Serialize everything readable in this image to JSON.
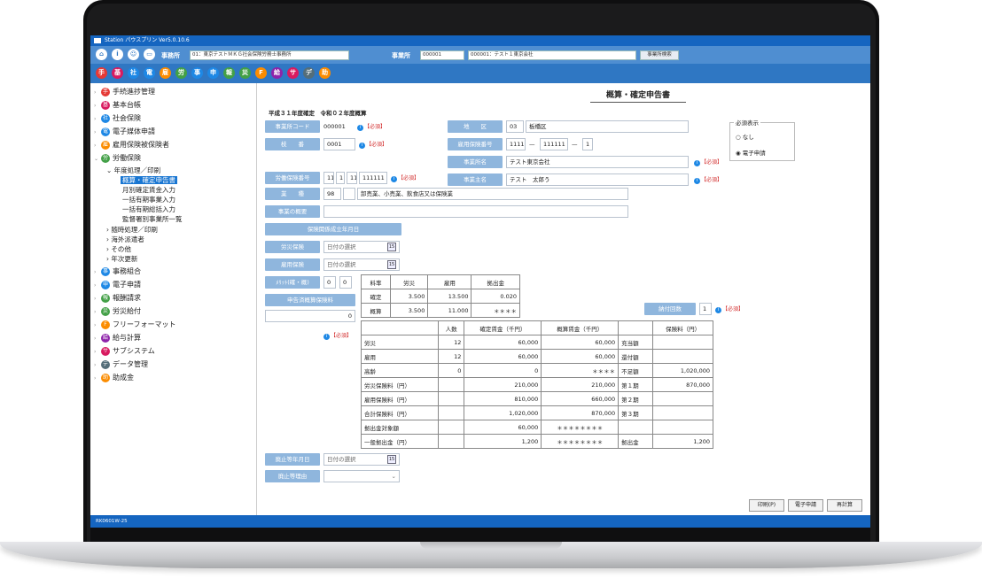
{
  "window": {
    "title": "Station パウスプリン Ver5.0.10.6"
  },
  "toolbar": {
    "office_label": "事務所",
    "office_select": "01：東京テストＭＫＧ社会保険労務士事務所",
    "business_label": "事業所",
    "business_code": "000001",
    "business_select": "000001：テスト１東京会社",
    "search_button": "事業所検索"
  },
  "sidebar": {
    "items": [
      {
        "label": "手続進捗管理",
        "color": "#e53935",
        "glyph": "手"
      },
      {
        "label": "基本台帳",
        "color": "#d81b60",
        "glyph": "基"
      },
      {
        "label": "社会保険",
        "color": "#1e88e5",
        "glyph": "社"
      },
      {
        "label": "電子媒体申請",
        "color": "#1e88e5",
        "glyph": "電"
      },
      {
        "label": "雇用保険被保険者",
        "color": "#fb8c00",
        "glyph": "雇"
      },
      {
        "label": "労働保険",
        "color": "#43a047",
        "glyph": "労"
      },
      {
        "label": "事務組合",
        "color": "#1e88e5",
        "glyph": "事"
      },
      {
        "label": "電子申請",
        "color": "#1e88e5",
        "glyph": "申"
      },
      {
        "label": "報酬請求",
        "color": "#43a047",
        "glyph": "報"
      },
      {
        "label": "労災給付",
        "color": "#43a047",
        "glyph": "災"
      },
      {
        "label": "フリーフォーマット",
        "color": "#fb8c00",
        "glyph": "F"
      },
      {
        "label": "給与計算",
        "color": "#8e24aa",
        "glyph": "給"
      },
      {
        "label": "サブシステム",
        "color": "#d81b60",
        "glyph": "サ"
      },
      {
        "label": "データ管理",
        "color": "#546e7a",
        "glyph": "デ"
      },
      {
        "label": "助成金",
        "color": "#fb8c00",
        "glyph": "助"
      }
    ],
    "sub_group": "年度処理／印刷",
    "sub_items": [
      "概算・確定申告書",
      "月別確定賃金入力",
      "一括有期事業入力",
      "一括有期総括入力",
      "監督署別事業所一覧"
    ],
    "other_items": [
      "随時処理／印刷",
      "海外派遣者",
      "その他",
      "年次更新"
    ]
  },
  "form": {
    "title": "概算・確定申告書",
    "year_note": "平成３１年度確定　令和０２年度概算",
    "required_tag": "【必須】",
    "office_code_label": "事業所コード",
    "office_code": "000001",
    "branch_label": "枝　　番",
    "branch": "0001",
    "district_label": "地　　区",
    "district_code": "03",
    "district_name": "板橋区",
    "emp_ins_no_label": "雇用保険番号",
    "emp_ins_no": [
      "1111",
      "111111",
      "1"
    ],
    "biz_name_label": "事業所名",
    "biz_name": "テスト東京会社",
    "owner_label": "事業主名",
    "owner": "テスト　太郎う",
    "labor_ins_no_label": "労働保険番号",
    "labor_ins_no": [
      "11",
      "1",
      "11",
      "111111"
    ],
    "industry_label": "業　　種",
    "industry_code": "98",
    "industry_name": "卸売業、小売業、飲食店又は保険業",
    "business_summary_label": "事業の概要",
    "established_label": "保険関係成立年月日",
    "rosai_label": "労災保険",
    "koyo_label": "雇用保険",
    "date_placeholder": "日付の選択",
    "maint_label": "ﾒﾘｯﾄ(確・概)",
    "maint": [
      "0",
      "0"
    ],
    "declared_label": "申告済概算保険料",
    "declared_value": "0",
    "installments_label": "納付回数",
    "installments": "1",
    "closure_date_label": "廃止等年月日",
    "closure_reason_label": "廃止等理由"
  },
  "required_panel": {
    "title": "必須表示",
    "options": [
      "なし",
      "電子申請"
    ],
    "selected": "電子申請"
  },
  "rate_table": {
    "headers": [
      "料率",
      "労災",
      "雇用",
      "拠出金"
    ],
    "rows": [
      [
        "確定",
        "3.500",
        "13.500",
        "0.020"
      ],
      [
        "概算",
        "3.500",
        "11.000",
        "＊＊＊＊"
      ]
    ]
  },
  "main_table": {
    "headers": [
      "",
      "人数",
      "確定賃金（千円）",
      "概算賃金（千円）",
      "",
      "保険料（円）"
    ],
    "rows": [
      [
        "労災",
        "12",
        "60,000",
        "60,000",
        "充当額",
        ""
      ],
      [
        "雇用",
        "12",
        "60,000",
        "60,000",
        "還付額",
        ""
      ],
      [
        "高齢",
        "0",
        "0",
        "＊＊＊＊",
        "不足額",
        "1,020,000"
      ],
      [
        "労災保険料（円）",
        "",
        "210,000",
        "210,000",
        "第１期",
        "870,000"
      ],
      [
        "雇用保険料（円）",
        "",
        "810,000",
        "660,000",
        "第２期",
        ""
      ],
      [
        "合計保険料（円）",
        "",
        "1,020,000",
        "870,000",
        "第３期",
        ""
      ],
      [
        "拠出金対象額",
        "",
        "60,000",
        "＊＊＊＊＊＊＊＊",
        "",
        ""
      ],
      [
        "一般拠出金（円）",
        "",
        "1,200",
        "＊＊＊＊＊＊＊＊",
        "拠出金",
        "1,200"
      ]
    ]
  },
  "buttons": {
    "print": "印刷(P)",
    "e_apply": "電子申請",
    "recalc": "再計算"
  },
  "status": {
    "text": "RK0601W-25"
  }
}
